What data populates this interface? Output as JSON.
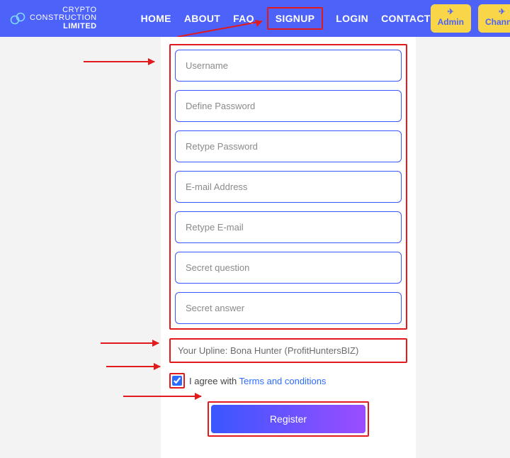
{
  "brand": {
    "line1": "CRYPTO CONSTRUCTION",
    "line2": "LIMITED"
  },
  "nav": {
    "home": "HOME",
    "about": "ABOUT",
    "faq": "FAQ",
    "signup": "SIGNUP",
    "login": "LOGIN",
    "contact": "CONTACT"
  },
  "actions": {
    "admin": "Admin",
    "channel": "Channel"
  },
  "form": {
    "username": "Username",
    "password": "Define Password",
    "retype_password": "Retype Password",
    "email": "E-mail Address",
    "retype_email": "Retype E-mail",
    "secret_q": "Secret question",
    "secret_a": "Secret answer"
  },
  "upline": "Your Upline: Bona Hunter (ProfitHuntersBIZ)",
  "terms": {
    "checked": true,
    "label_before": "I agree with ",
    "link": "Terms and conditions"
  },
  "register": "Register"
}
